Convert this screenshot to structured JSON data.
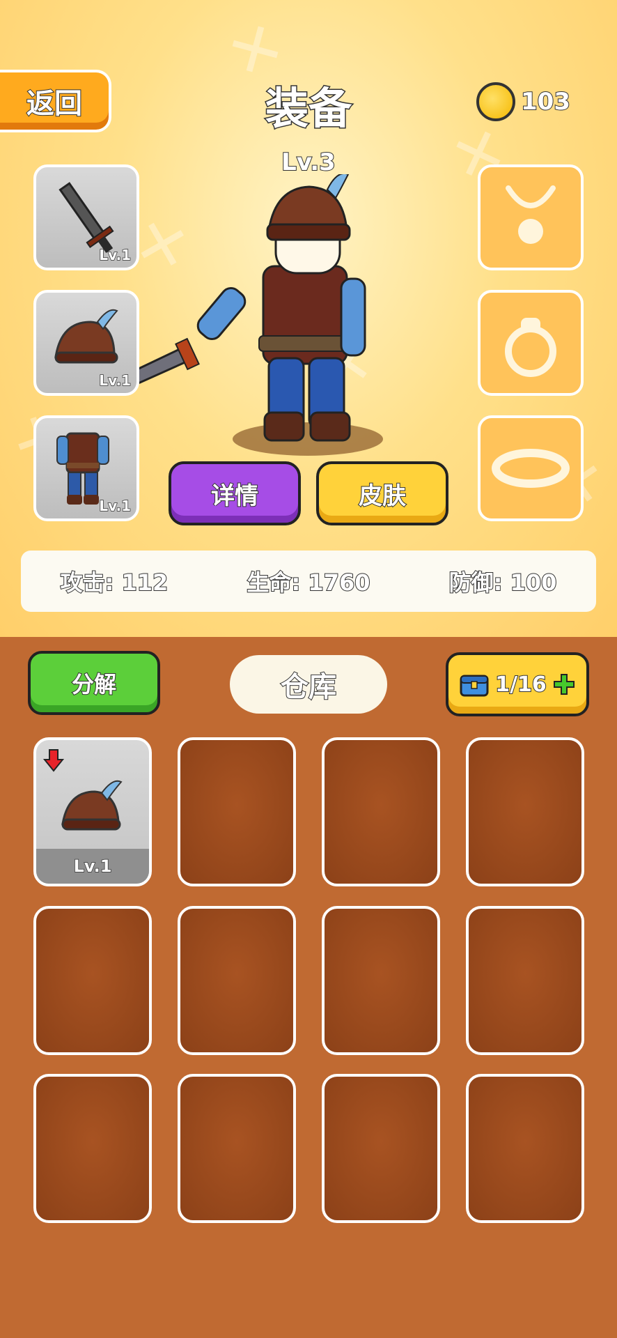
{
  "header": {
    "back_label": "返回",
    "title": "装备",
    "coins": "103"
  },
  "character": {
    "level": "Lv.3"
  },
  "equipped_left": [
    {
      "icon": "sword-icon",
      "level": "Lv.1"
    },
    {
      "icon": "helmet-icon",
      "level": "Lv.1"
    },
    {
      "icon": "armor-icon",
      "level": "Lv.1"
    }
  ],
  "equipped_right": [
    {
      "icon": "necklace-icon"
    },
    {
      "icon": "ring-icon"
    },
    {
      "icon": "bracelet-icon"
    }
  ],
  "actions": {
    "details_label": "详情",
    "skin_label": "皮肤"
  },
  "stats": {
    "attack": "攻击: 112",
    "hp": "生命: 1760",
    "defense": "防御: 100"
  },
  "inventory": {
    "decompose_label": "分解",
    "title": "仓库",
    "capacity": "1/16",
    "items": [
      {
        "icon": "helmet-icon",
        "level": "Lv.1",
        "upgrade_arrow": true
      }
    ]
  },
  "colors": {
    "accent_orange": "#ffaa1e",
    "purple": "#a64de6",
    "yellow": "#ffd23a",
    "green": "#5ccf3a",
    "panel_brown": "#c06a32"
  }
}
